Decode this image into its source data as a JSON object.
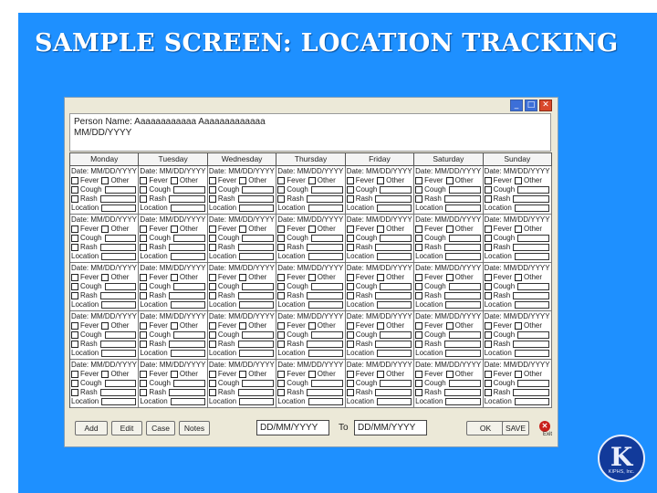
{
  "slide": {
    "title": "SAMPLE SCREEN: LOCATION TRACKING",
    "background_color": "#1e90ff"
  },
  "window": {
    "controls": [
      "minimize-icon",
      "maximize-icon",
      "close-icon"
    ],
    "person_label": "Person Name:",
    "person_value": "Aaaaaaaaaaaa  Aaaaaaaaaaaaa",
    "person_date": "MM/DD/YYYY"
  },
  "days": [
    "Monday",
    "Tuesday",
    "Wednesday",
    "Thursday",
    "Friday",
    "Saturday",
    "Sunday"
  ],
  "cell": {
    "date_label": "Date: MM/DD/YYYY",
    "fever": "Fever",
    "other": "Other",
    "cough": "Cough",
    "rash": "Rash",
    "location": "Location"
  },
  "toolbar": {
    "add": "Add",
    "edit": "Edit",
    "case": "Case",
    "notes": "Notes",
    "from_date": "DD/MM/YYYY",
    "to_label": "To",
    "to_date": "DD/MM/YYYY",
    "ok": "OK",
    "save": "SAVE",
    "exit": "Exit"
  },
  "logo": {
    "letter": "K",
    "text": "KIPHS, Inc."
  }
}
